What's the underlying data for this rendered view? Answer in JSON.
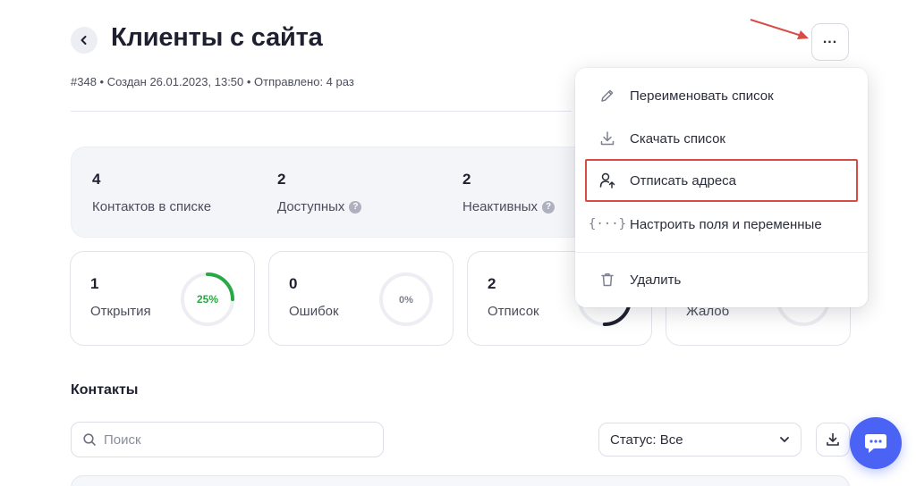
{
  "header": {
    "title": "Клиенты с сайта",
    "meta": "#348 • Создан 26.01.2023, 13:50 • Отправлено: 4 раз"
  },
  "summary": {
    "items": [
      {
        "value": "4",
        "label": "Контактов в списке",
        "help": false
      },
      {
        "value": "2",
        "label": "Доступных",
        "help": true
      },
      {
        "value": "2",
        "label": "Неактивных",
        "help": true
      }
    ]
  },
  "metrics": [
    {
      "value": "1",
      "label": "Открытия",
      "percent_text": "25%",
      "percent": 25,
      "color": "#2aa845"
    },
    {
      "value": "0",
      "label": "Ошибок",
      "percent_text": "0%",
      "percent": 0,
      "color": "#9aa0ad"
    },
    {
      "value": "2",
      "label": "Отписок",
      "percent_text": "",
      "percent": 50,
      "color": "#1e2030"
    },
    {
      "value": "",
      "label": "Жалоб",
      "percent_text": "",
      "percent": 0,
      "color": "#9aa0ad"
    }
  ],
  "contacts": {
    "title": "Контакты",
    "search_placeholder": "Поиск",
    "status_label": "Статус: Все"
  },
  "menu": {
    "items": [
      {
        "label": "Переименовать список",
        "icon": "pencil-icon"
      },
      {
        "label": "Скачать список",
        "icon": "download-icon"
      },
      {
        "label": "Отписать адреса",
        "icon": "user-unsubscribe-icon"
      },
      {
        "label": "Настроить поля и переменные",
        "icon": "braces-icon"
      },
      {
        "label": "Удалить",
        "icon": "trash-icon"
      }
    ]
  },
  "colors": {
    "accent": "#4b63f5",
    "highlight": "#d64d48",
    "success": "#2aa845",
    "annotation_arrow": "#d64d48"
  }
}
